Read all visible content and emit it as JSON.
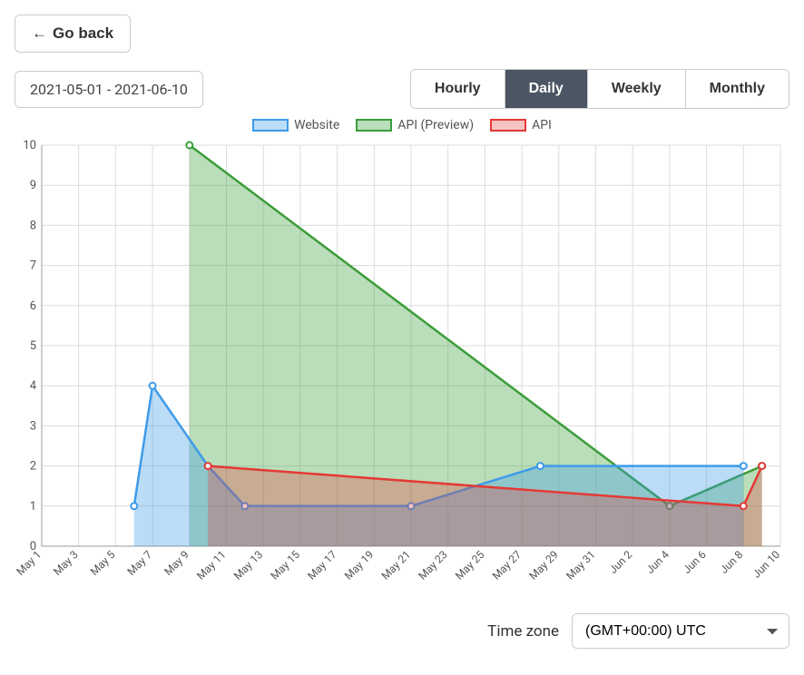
{
  "go_back_label": "Go back",
  "date_range": "2021-05-01 - 2021-06-10",
  "granularity": {
    "options": [
      "Hourly",
      "Daily",
      "Weekly",
      "Monthly"
    ],
    "active": "Daily"
  },
  "legend": {
    "website": "Website",
    "api_preview": "API (Preview)",
    "api": "API"
  },
  "timezone_label": "Time zone",
  "timezone_value": "(GMT+00:00) UTC",
  "colors": {
    "website_stroke": "#3d9be9",
    "website_fill": "rgba(61,155,233,0.35)",
    "api_preview_stroke": "#3a9d3a",
    "api_preview_fill": "rgba(58,157,58,0.35)",
    "api_stroke": "#e53935",
    "api_fill": "rgba(229,57,53,0.30)"
  },
  "chart_data": {
    "type": "area",
    "xlabel": "",
    "ylabel": "",
    "ylim": [
      0,
      10
    ],
    "y_ticks": [
      0,
      1,
      2,
      3,
      4,
      5,
      6,
      7,
      8,
      9,
      10
    ],
    "x_categories": [
      "May 1",
      "May 3",
      "May 5",
      "May 7",
      "May 9",
      "May 11",
      "May 13",
      "May 15",
      "May 17",
      "May 19",
      "May 21",
      "May 23",
      "May 25",
      "May 27",
      "May 29",
      "May 31",
      "Jun 2",
      "Jun 4",
      "Jun 6",
      "Jun 8",
      "Jun 10"
    ],
    "series": [
      {
        "name": "API (Preview)",
        "stroke": "#3a9d3a",
        "fill": "rgba(58,157,58,0.35)",
        "points": [
          {
            "x": "May 9",
            "y": 10
          },
          {
            "x": "Jun 4",
            "y": 1
          },
          {
            "x": "Jun 9",
            "y": 2
          }
        ]
      },
      {
        "name": "Website",
        "stroke": "#3d9be9",
        "fill": "rgba(61,155,233,0.35)",
        "points": [
          {
            "x": "May 6",
            "y": 1
          },
          {
            "x": "May 7",
            "y": 4
          },
          {
            "x": "May 10",
            "y": 2
          },
          {
            "x": "May 12",
            "y": 1
          },
          {
            "x": "May 21",
            "y": 1
          },
          {
            "x": "May 28",
            "y": 2
          },
          {
            "x": "Jun 8",
            "y": 2
          }
        ]
      },
      {
        "name": "API",
        "stroke": "#e53935",
        "fill": "rgba(229,57,53,0.30)",
        "points": [
          {
            "x": "May 10",
            "y": 2
          },
          {
            "x": "Jun 8",
            "y": 1
          },
          {
            "x": "Jun 9",
            "y": 2
          }
        ]
      }
    ]
  }
}
